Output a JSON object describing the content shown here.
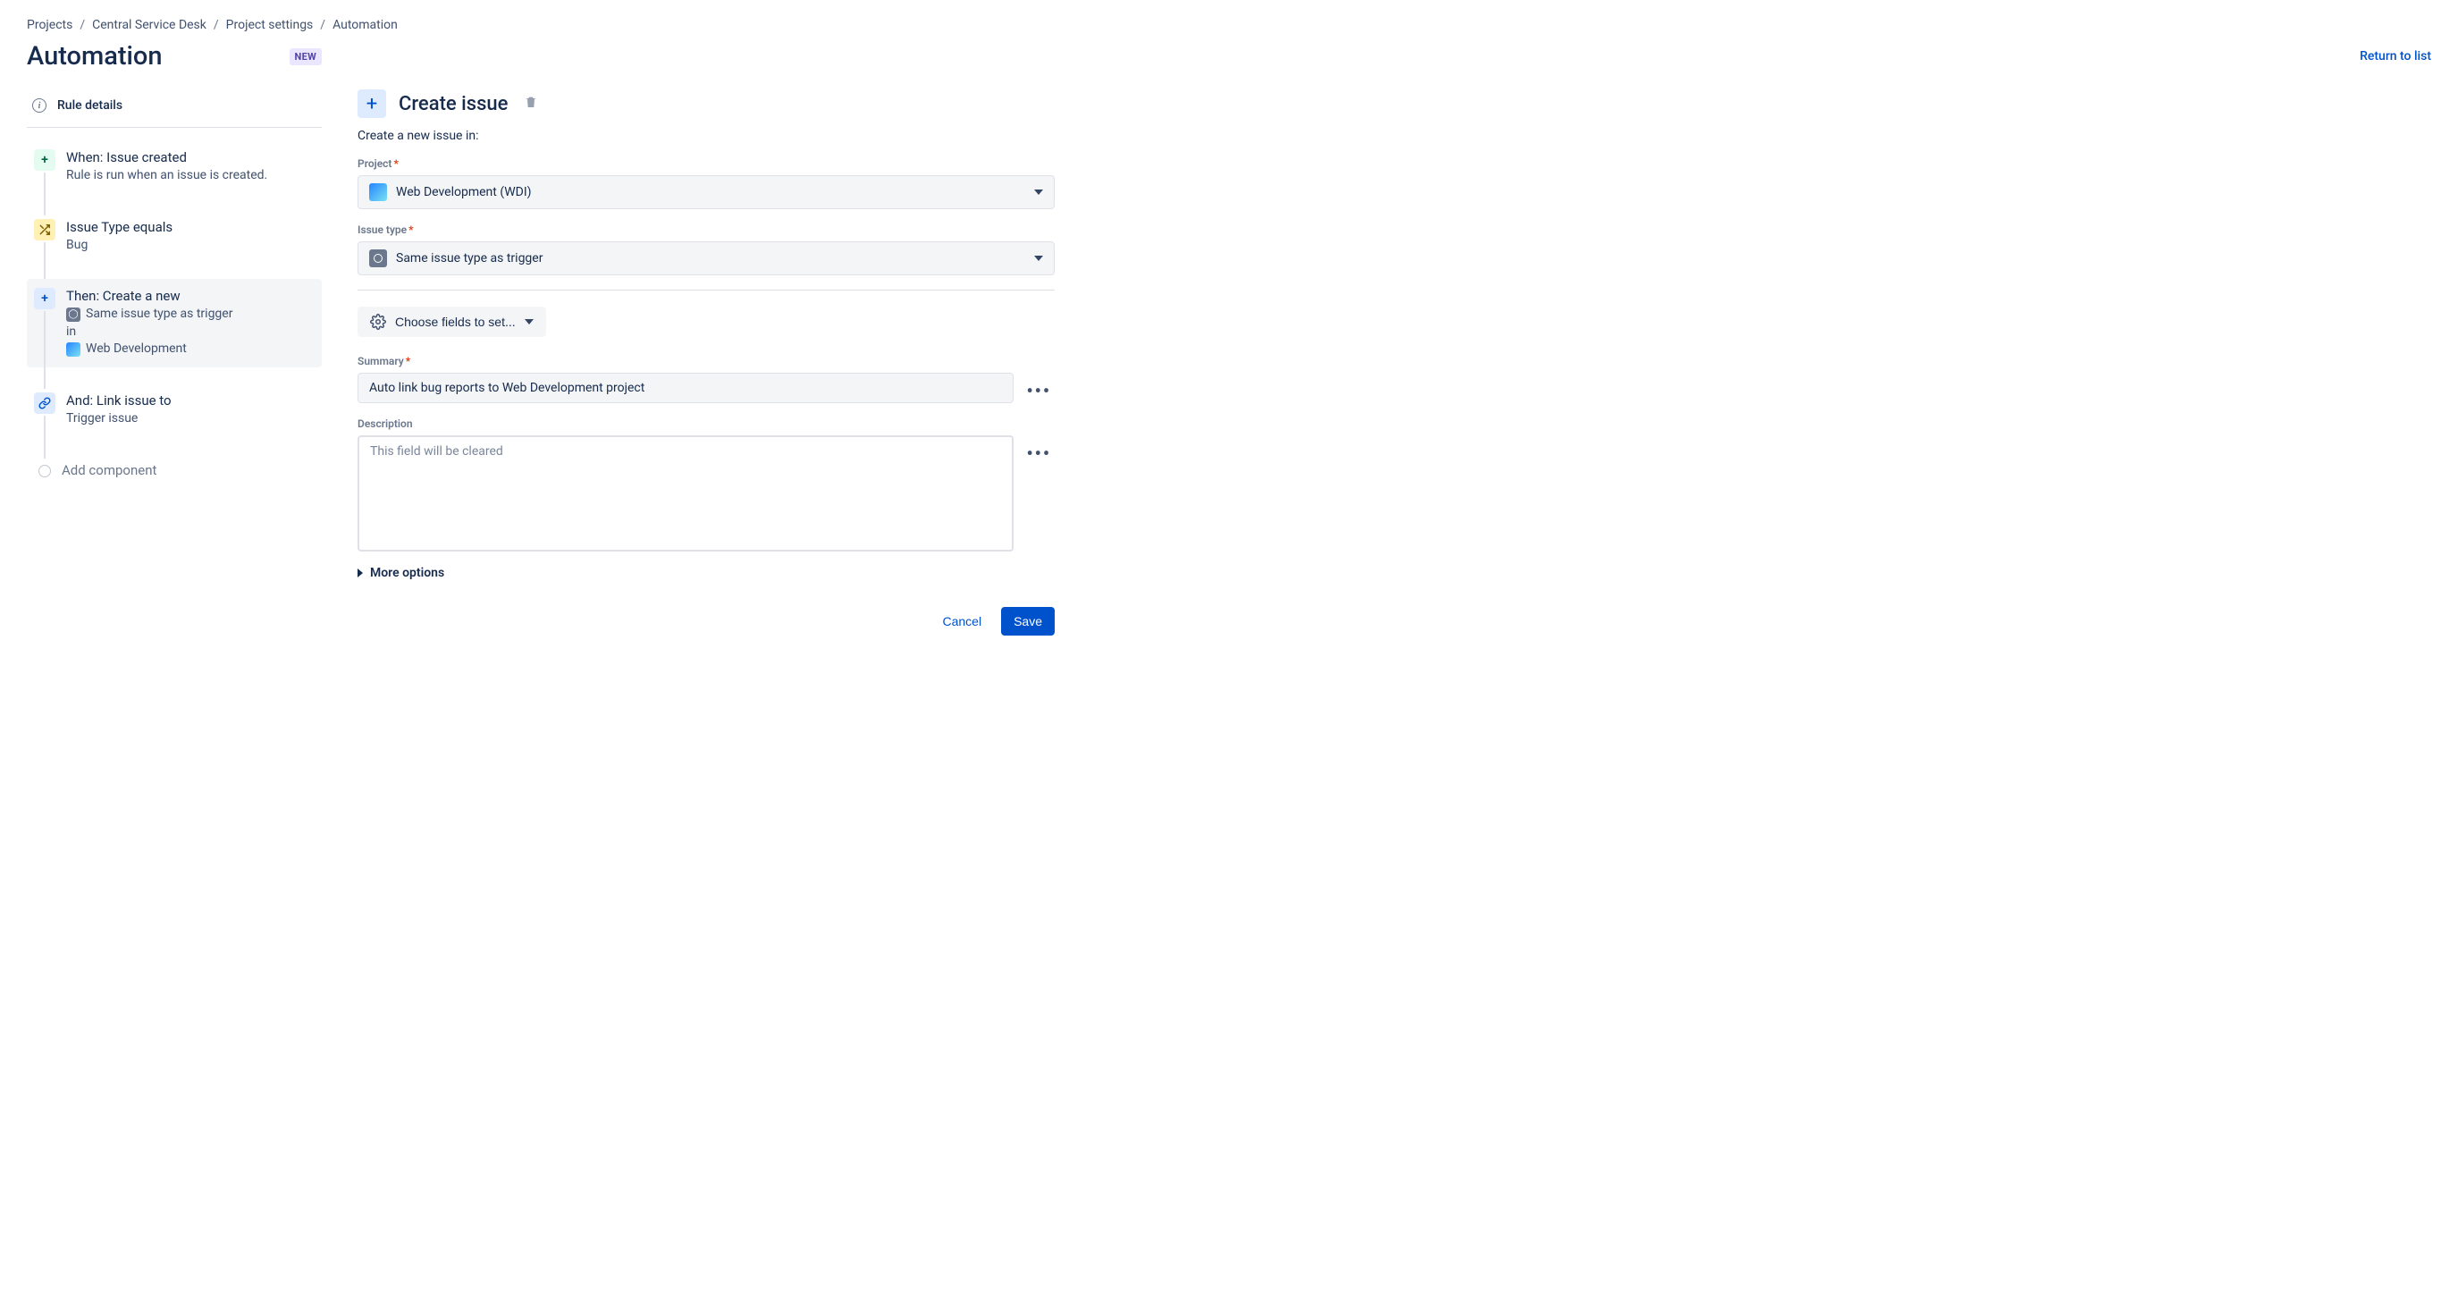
{
  "breadcrumb": {
    "items": [
      "Projects",
      "Central Service Desk",
      "Project settings",
      "Automation"
    ]
  },
  "header": {
    "title": "Automation",
    "badge": "NEW",
    "return_link": "Return to list"
  },
  "sidebar": {
    "rule_details": "Rule details",
    "steps": {
      "trigger": {
        "title": "When: Issue created",
        "sub": "Rule is run when an issue is created."
      },
      "condition": {
        "title": "Issue Type equals",
        "sub": "Bug"
      },
      "action_create": {
        "title": "Then: Create a new",
        "sub1": "Same issue type as trigger",
        "sub_in": "in",
        "sub2": "Web Development"
      },
      "action_link": {
        "title": "And: Link issue to",
        "sub": "Trigger issue"
      },
      "add": "Add component"
    }
  },
  "panel": {
    "title": "Create issue",
    "subtitle": "Create a new issue in:",
    "project_label": "Project",
    "project_value": "Web Development (WDI)",
    "issuetype_label": "Issue type",
    "issuetype_value": "Same issue type as trigger",
    "choose_fields": "Choose fields to set...",
    "summary_label": "Summary",
    "summary_value": "Auto link bug reports to Web Development project",
    "description_label": "Description",
    "description_placeholder": "This field will be cleared",
    "more_options": "More options",
    "cancel": "Cancel",
    "save": "Save"
  }
}
